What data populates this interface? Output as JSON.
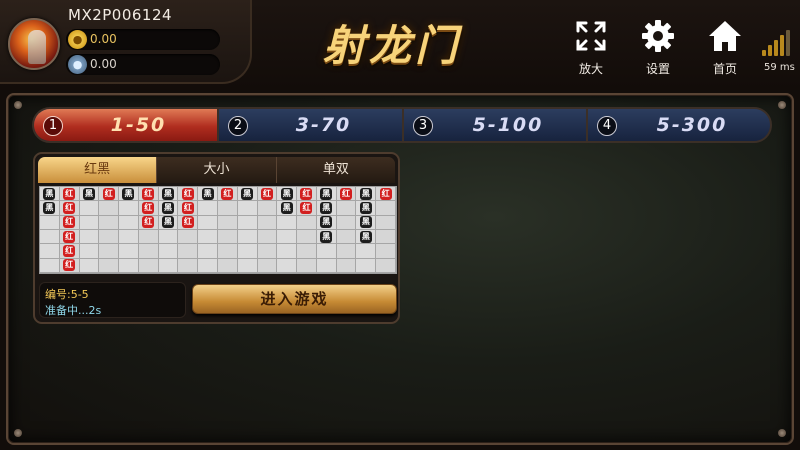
{
  "player": {
    "id": "MX2P006124",
    "gold_balance": "0.00",
    "silver_balance": "0.00"
  },
  "title": "射龙门",
  "toolbar": {
    "zoom_label": "放大",
    "settings_label": "设置",
    "home_label": "首页",
    "latency": "59 ms"
  },
  "bet_tabs": [
    {
      "num": "1",
      "label": "1-50",
      "active": true
    },
    {
      "num": "2",
      "label": "3-70",
      "active": false
    },
    {
      "num": "3",
      "label": "5-100",
      "active": false
    },
    {
      "num": "4",
      "label": "5-300",
      "active": false
    }
  ],
  "room": {
    "tabs": [
      "红黑",
      "大小",
      "单双"
    ],
    "active_tab": "红黑",
    "bead_road": {
      "columns": 18,
      "rows": 6,
      "red_label": "红",
      "black_label": "黑",
      "cols": [
        [
          "黑",
          "黑"
        ],
        [
          "红",
          "红",
          "红",
          "红",
          "红",
          "红"
        ],
        [
          "黑"
        ],
        [
          "红"
        ],
        [
          "黑"
        ],
        [
          "红",
          "红",
          "红"
        ],
        [
          "黑",
          "黑",
          "黑"
        ],
        [
          "红",
          "红",
          "红"
        ],
        [
          "黑"
        ],
        [
          "红"
        ],
        [
          "黑"
        ],
        [
          "红"
        ],
        [
          "黑",
          "黑"
        ],
        [
          "红",
          "红"
        ],
        [
          "黑",
          "黑",
          "黑",
          "黑"
        ],
        [
          "红"
        ],
        [
          "黑",
          "黑",
          "黑",
          "黑"
        ],
        [
          "红"
        ]
      ]
    },
    "room_id_label": "编号:5-5",
    "status_label": "准备中...2s",
    "enter_label": "进入游戏"
  }
}
